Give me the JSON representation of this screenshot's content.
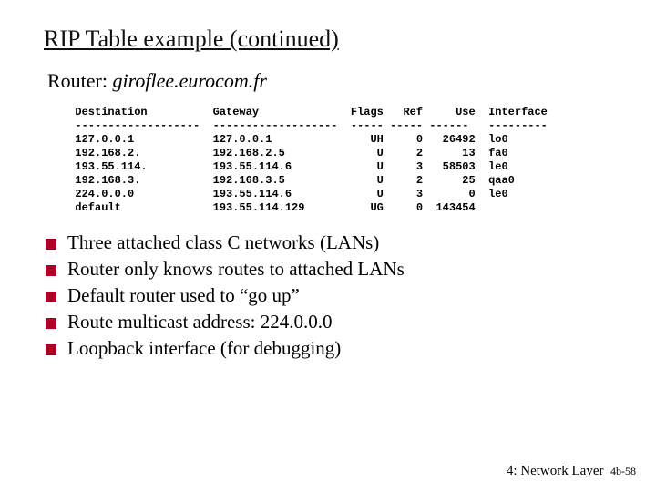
{
  "title": "RIP Table example (continued)",
  "router_label": "Router: ",
  "router_host": "giroflee.eurocom.fr",
  "table": {
    "headers": [
      "Destination",
      "Gateway",
      "Flags",
      "Ref",
      "Use",
      "Interface"
    ],
    "dashes": [
      "-------------------",
      "-------------------",
      "-----",
      "-----",
      "------",
      "---------"
    ],
    "rows": [
      {
        "dest": "127.0.0.1",
        "gw": "127.0.0.1",
        "flags": "UH",
        "ref": "0",
        "use": "26492",
        "iface": "lo0"
      },
      {
        "dest": "192.168.2.",
        "gw": "192.168.2.5",
        "flags": "U",
        "ref": "2",
        "use": "13",
        "iface": "fa0"
      },
      {
        "dest": "193.55.114.",
        "gw": "193.55.114.6",
        "flags": "U",
        "ref": "3",
        "use": "58503",
        "iface": "le0"
      },
      {
        "dest": "192.168.3.",
        "gw": "192.168.3.5",
        "flags": "U",
        "ref": "2",
        "use": "25",
        "iface": "qaa0"
      },
      {
        "dest": "224.0.0.0",
        "gw": "193.55.114.6",
        "flags": "U",
        "ref": "3",
        "use": "0",
        "iface": "le0"
      },
      {
        "dest": "default",
        "gw": "193.55.114.129",
        "flags": "UG",
        "ref": "0",
        "use": "143454",
        "iface": ""
      }
    ]
  },
  "bullets": [
    "Three attached class C networks (LANs)",
    "Router only knows routes to attached LANs",
    "Default router used to “go up”",
    "Route multicast address: 224.0.0.0",
    "Loopback interface (for debugging)"
  ],
  "footer_chapter": "4: Network Layer",
  "footer_page": "4b-58"
}
